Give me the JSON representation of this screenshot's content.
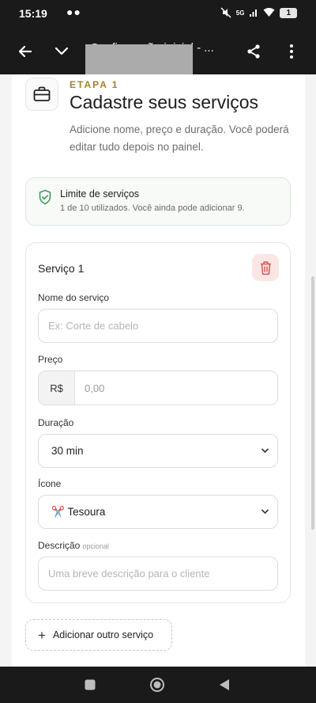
{
  "status": {
    "time": "15:19",
    "dots": "●●",
    "network": "5G",
    "battery": "1"
  },
  "app_bar": {
    "title": "Configuração inicial - ..."
  },
  "step": {
    "label": "ETAPA 1",
    "title": "Cadastre seus serviços",
    "description": "Adicione nome, preço e duração. Você poderá editar tudo depois no painel."
  },
  "limit": {
    "title": "Limite de serviços",
    "text": "1 de 10 utilizados. Você ainda pode adicionar 9."
  },
  "service": {
    "title": "Serviço 1",
    "name_label": "Nome do serviço",
    "name_placeholder": "Ex: Corte de cabelo",
    "price_label": "Preço",
    "price_prefix": "R$",
    "price_placeholder": "0,00",
    "duration_label": "Duração",
    "duration_value": "30 min",
    "icon_label": "Ícone",
    "icon_value": "✂️ Tesoura",
    "description_label": "Descrição",
    "description_optional": "opcional",
    "description_placeholder": "Uma breve descrição para o cliente"
  },
  "add_button": {
    "plus": "+",
    "label": "Adicionar outro serviço"
  },
  "colors": {
    "accent_gold": "#a5812a",
    "delete_red": "#d9534f",
    "shield_green": "#3a9d5d"
  },
  "icons": {
    "back": "arrow-left-icon",
    "collapse": "chevron-down-icon",
    "share": "share-icon",
    "menu": "more-vert-icon",
    "step": "briefcase-icon",
    "limit": "shield-check-icon",
    "delete": "trash-icon"
  }
}
